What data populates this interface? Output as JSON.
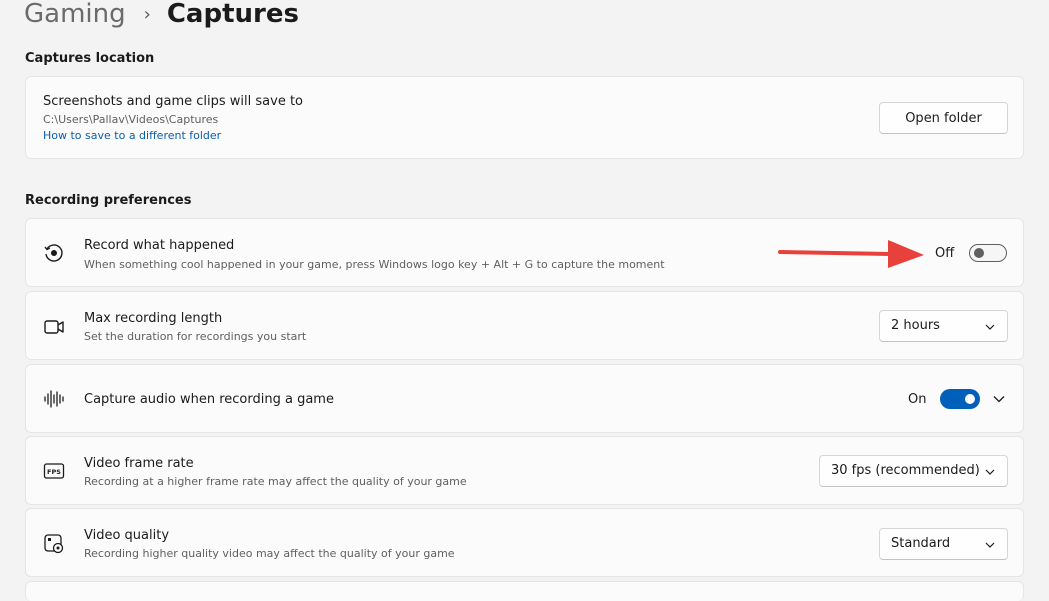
{
  "breadcrumb": {
    "parent": "Gaming",
    "separator": "›",
    "current": "Captures"
  },
  "captures_location": {
    "section_title": "Captures location",
    "title": "Screenshots and game clips will save to",
    "path": "C:\\Users\\Pallav\\Videos\\Captures",
    "link": "How to save to a different folder",
    "button": "Open folder"
  },
  "recording": {
    "section_title": "Recording preferences",
    "record_what_happened": {
      "title": "Record what happened",
      "subtitle": "When something cool happened in your game, press Windows logo key + Alt + G to capture the moment",
      "state_label": "Off",
      "state": false
    },
    "max_length": {
      "title": "Max recording length",
      "subtitle": "Set the duration for recordings you start",
      "value": "2 hours"
    },
    "capture_audio": {
      "title": "Capture audio when recording a game",
      "state_label": "On",
      "state": true
    },
    "frame_rate": {
      "title": "Video frame rate",
      "subtitle": "Recording at a higher frame rate may affect the quality of your game",
      "value": "30 fps (recommended)"
    },
    "quality": {
      "title": "Video quality",
      "subtitle": "Recording higher quality video may affect the quality of your game",
      "value": "Standard"
    }
  },
  "icons": {
    "record": "record-icon",
    "video": "video-camera-icon",
    "audio": "audio-waveform-icon",
    "fps": "fps-icon",
    "quality": "video-settings-icon"
  },
  "colors": {
    "accent": "#005fb8",
    "annotation_arrow": "#e8403a"
  }
}
